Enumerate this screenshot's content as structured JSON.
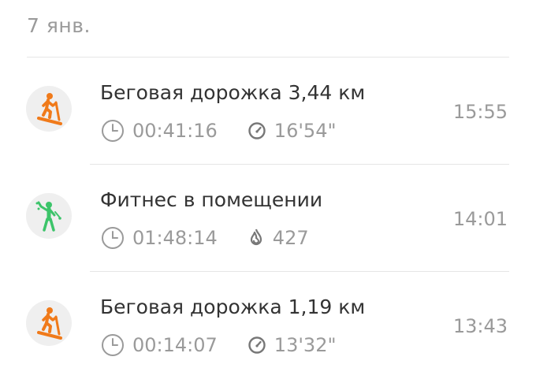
{
  "date_label": "7 янв.",
  "colors": {
    "treadmill": "#f07a1a",
    "fitness": "#3cc46a",
    "secondary_text": "#9a9a9a",
    "primary_text": "#333333"
  },
  "activities": [
    {
      "title": "Беговая дорожка 3,44 км",
      "icon": "treadmill-icon",
      "duration": "00:41:16",
      "second_stat_icon": "pace-icon",
      "second_stat": "16'54\"",
      "time": "15:55"
    },
    {
      "title": "Фитнес в помещении",
      "icon": "indoor-fitness-icon",
      "duration": "01:48:14",
      "second_stat_icon": "calories-flame-icon",
      "second_stat": "427",
      "time": "14:01"
    },
    {
      "title": "Беговая дорожка 1,19 км",
      "icon": "treadmill-icon",
      "duration": "00:14:07",
      "second_stat_icon": "pace-icon",
      "second_stat": "13'32\"",
      "time": "13:43"
    }
  ]
}
